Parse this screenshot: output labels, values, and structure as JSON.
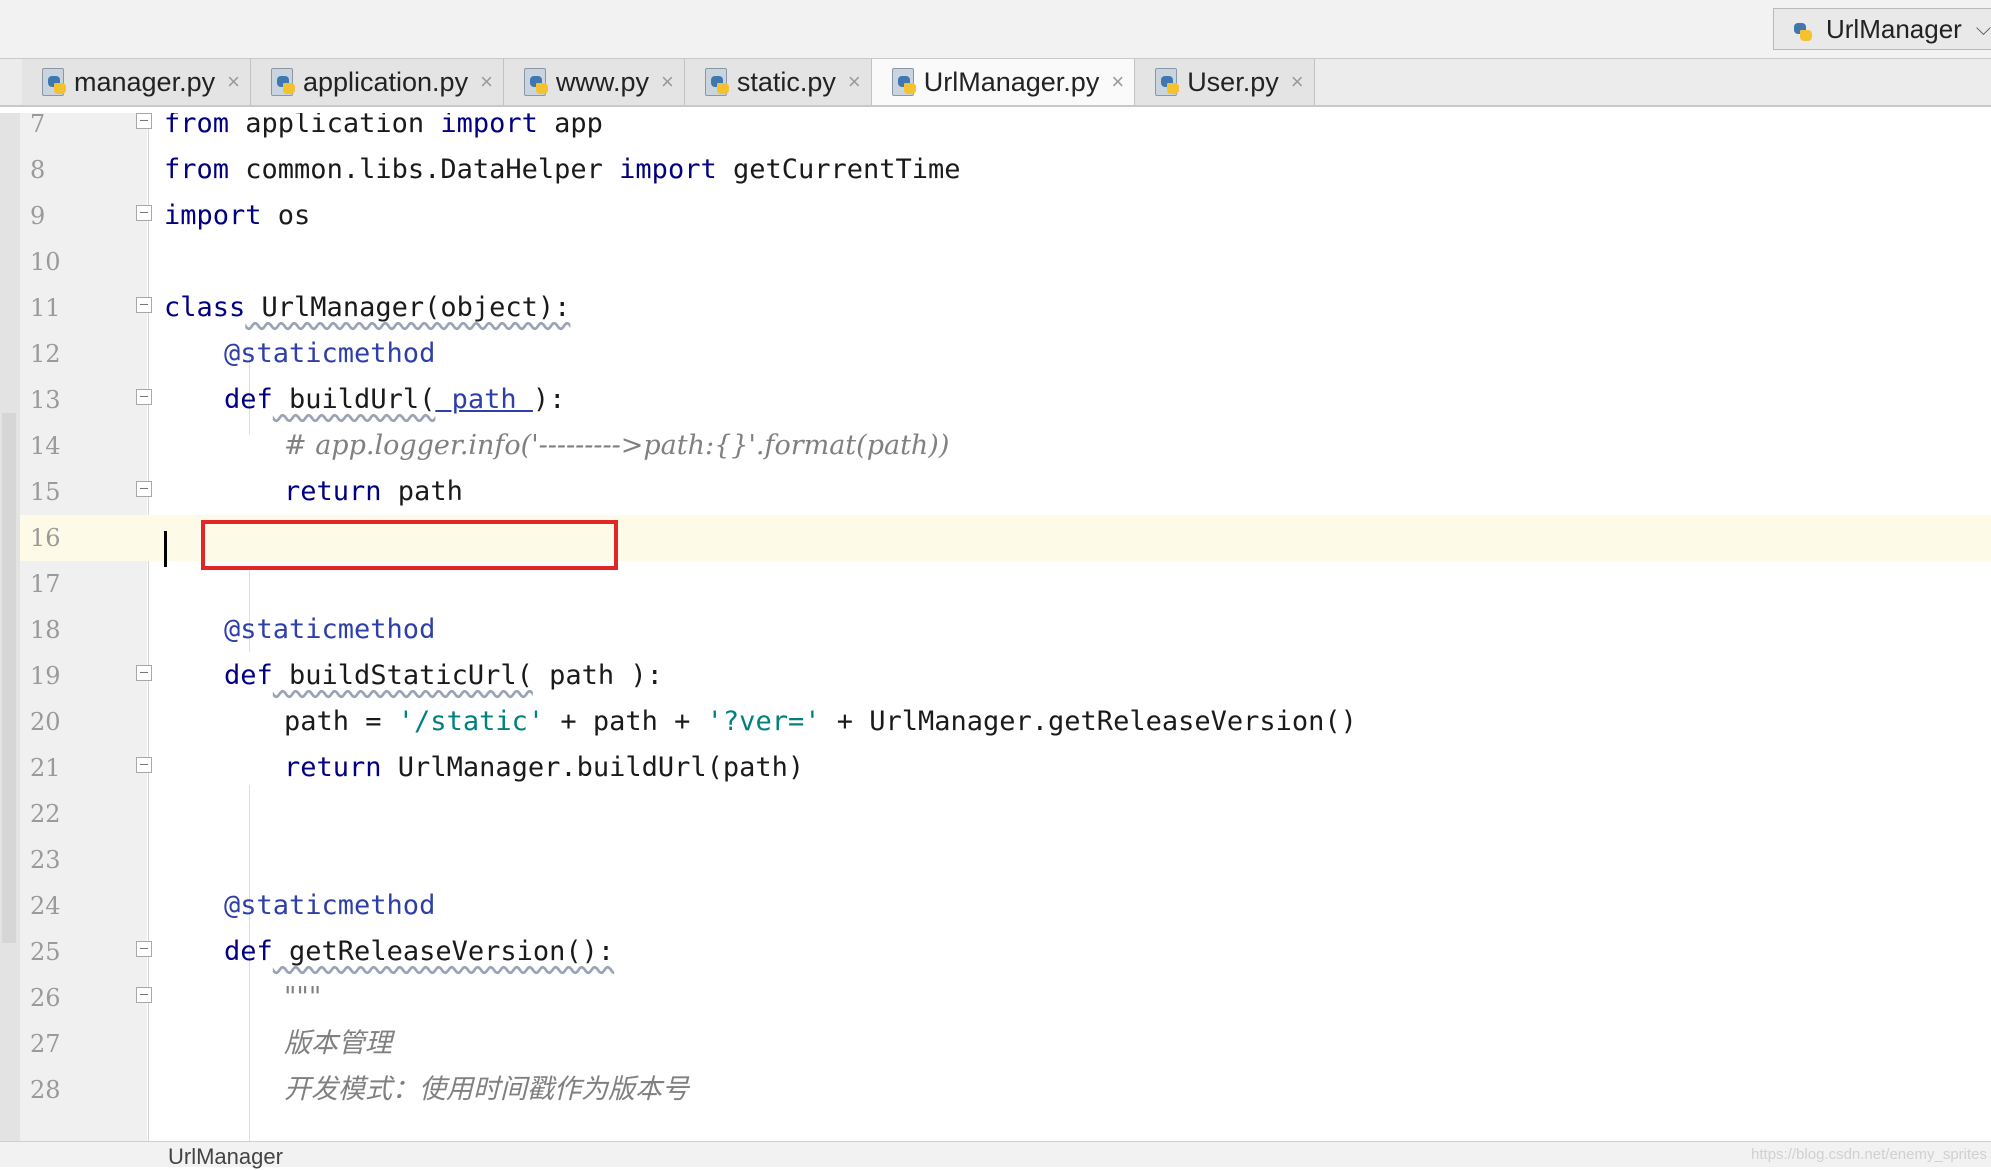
{
  "run_config": {
    "label": "UrlManager"
  },
  "tabs": [
    {
      "label": "manager.py",
      "active": false
    },
    {
      "label": "application.py",
      "active": false
    },
    {
      "label": "www.py",
      "active": false
    },
    {
      "label": "static.py",
      "active": false
    },
    {
      "label": "UrlManager.py",
      "active": true
    },
    {
      "label": "User.py",
      "active": false
    }
  ],
  "tab_close_glyph": "×",
  "lines": {
    "n7": "7",
    "n8": "8",
    "n9": "9",
    "n10": "10",
    "n11": "11",
    "n12": "12",
    "n13": "13",
    "n14": "14",
    "n15": "15",
    "n16": "16",
    "n17": "17",
    "n18": "18",
    "n19": "19",
    "n20": "20",
    "n21": "21",
    "n22": "22",
    "n23": "23",
    "n24": "24",
    "n25": "25",
    "n26": "26",
    "n27": "27",
    "n28": "28"
  },
  "code": {
    "l7": {
      "kw1": "from",
      "mod": " application ",
      "kw2": "import",
      "name": " app"
    },
    "l8": {
      "kw1": "from",
      "mod": " common.libs.DataHelper ",
      "kw2": "import",
      "name": " getCurrentTime"
    },
    "l9": {
      "kw1": "import",
      "name": " os"
    },
    "l11": {
      "kw": "class",
      "sig": " UrlManager(object):"
    },
    "l12": {
      "dec": "@staticmethod"
    },
    "l13": {
      "kw": "def",
      "name": " buildUrl(",
      "param": " path ",
      "end": "):"
    },
    "l14": {
      "comment": "# app.logger.info('--------->path:{}'.format(path))"
    },
    "l15": {
      "kw": "return",
      "rest": " path"
    },
    "l18": {
      "dec": "@staticmethod"
    },
    "l19": {
      "kw": "def",
      "name": " buildStaticUrl(",
      "param": " path ",
      "end": "):"
    },
    "l20": {
      "a": "path = ",
      "s1": "'/static'",
      "b": " + path + ",
      "s2": "'?ver='",
      "c": " + UrlManager.getReleaseVersion()"
    },
    "l21": {
      "kw": "return",
      "rest": " UrlManager.buildUrl(path)"
    },
    "l24": {
      "dec": "@staticmethod"
    },
    "l25": {
      "kw": "def",
      "name": " getReleaseVersion():"
    },
    "l26": {
      "doc": "\"\"\""
    },
    "l27": {
      "doc": "版本管理"
    },
    "l28": {
      "doc": "开发模式：使用时间戳作为版本号"
    }
  },
  "status": {
    "breadcrumb": "UrlManager"
  },
  "watermark": "https://blog.csdn.net/enemy_sprites",
  "colors": {
    "keyword": "#000080",
    "string": "#008080",
    "decorator": "#2e3fa8",
    "comment": "#808080",
    "highlight_box": "#e02626",
    "current_line": "#fdfbe8"
  }
}
